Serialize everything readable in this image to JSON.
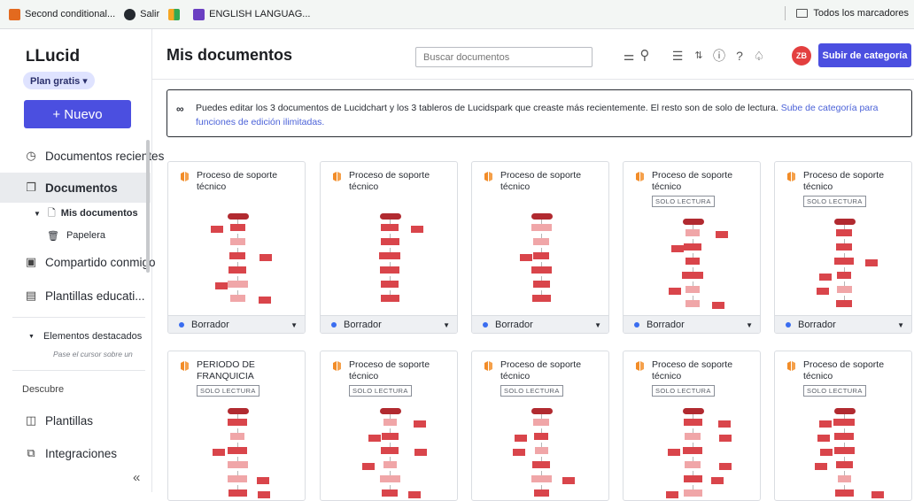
{
  "bookmarks": [
    {
      "label": "Second conditional...",
      "icon": "grid-icon",
      "color": "#e36a1f"
    },
    {
      "label": "Salir",
      "icon": "github-icon",
      "color": "#24292f"
    },
    {
      "label": "",
      "icon": "pinwheel-icon",
      "color": "#f5a623"
    },
    {
      "label": "ENGLISH LANGUAG...",
      "icon": "forms-icon",
      "color": "#6a3fc2"
    }
  ],
  "bookmarks_folder": "Todos los marcadores",
  "app": {
    "logo": "Lucid",
    "plan": "Plan gratis ▾",
    "new_label": "+ Nuevo"
  },
  "sidebar": {
    "recent": "Documentos recientes",
    "documents": "Documentos",
    "my_docs": "Mis documentos",
    "trash": "Papelera",
    "shared": "Compartido conmigo",
    "templates_edu": "Plantillas educati...",
    "featured": "Elementos destacados",
    "featured_hint": "Pase el cursor sobre un",
    "discover": "Descubre",
    "templates": "Plantillas",
    "integrations": "Integraciones",
    "collapse": "«"
  },
  "topbar": {
    "title": "Mis documentos",
    "search_placeholder": "Buscar documentos",
    "upgrade": "Subir de categoría",
    "avatar": "ZB"
  },
  "banner": {
    "text": "Puedes editar los 3 documentos de Lucidchart y los 3 tableros de Lucidspark que creaste más recientemente. El resto son de solo de lectura.",
    "link": "Sube de categoría para funciones de edición ilimitadas."
  },
  "colors": {
    "accent": "#4b4fe0",
    "chart_red": "#d9454b",
    "doc_icon": "#f28c28"
  },
  "cards_row1": [
    {
      "title": "Proceso de soporte técnico",
      "badge": "",
      "status": "Borrador"
    },
    {
      "title": "Proceso de soporte técnico",
      "badge": "",
      "status": "Borrador"
    },
    {
      "title": "Proceso de soporte técnico",
      "badge": "",
      "status": "Borrador"
    },
    {
      "title": "Proceso de soporte técnico",
      "badge": "SOLO LECTURA",
      "status": "Borrador"
    },
    {
      "title": "Proceso de soporte técnico",
      "badge": "SOLO LECTURA",
      "status": "Borrador"
    }
  ],
  "cards_row2": [
    {
      "title": "PERIODO DE FRANQUICIA",
      "badge": "SOLO LECTURA"
    },
    {
      "title": "Proceso de soporte técnico",
      "badge": "SOLO LECTURA"
    },
    {
      "title": "Proceso de soporte técnico",
      "badge": "SOLO LECTURA"
    },
    {
      "title": "Proceso de soporte técnico",
      "badge": "SOLO LECTURA"
    },
    {
      "title": "Proceso de soporte técnico",
      "badge": "SOLO LECTURA"
    }
  ]
}
